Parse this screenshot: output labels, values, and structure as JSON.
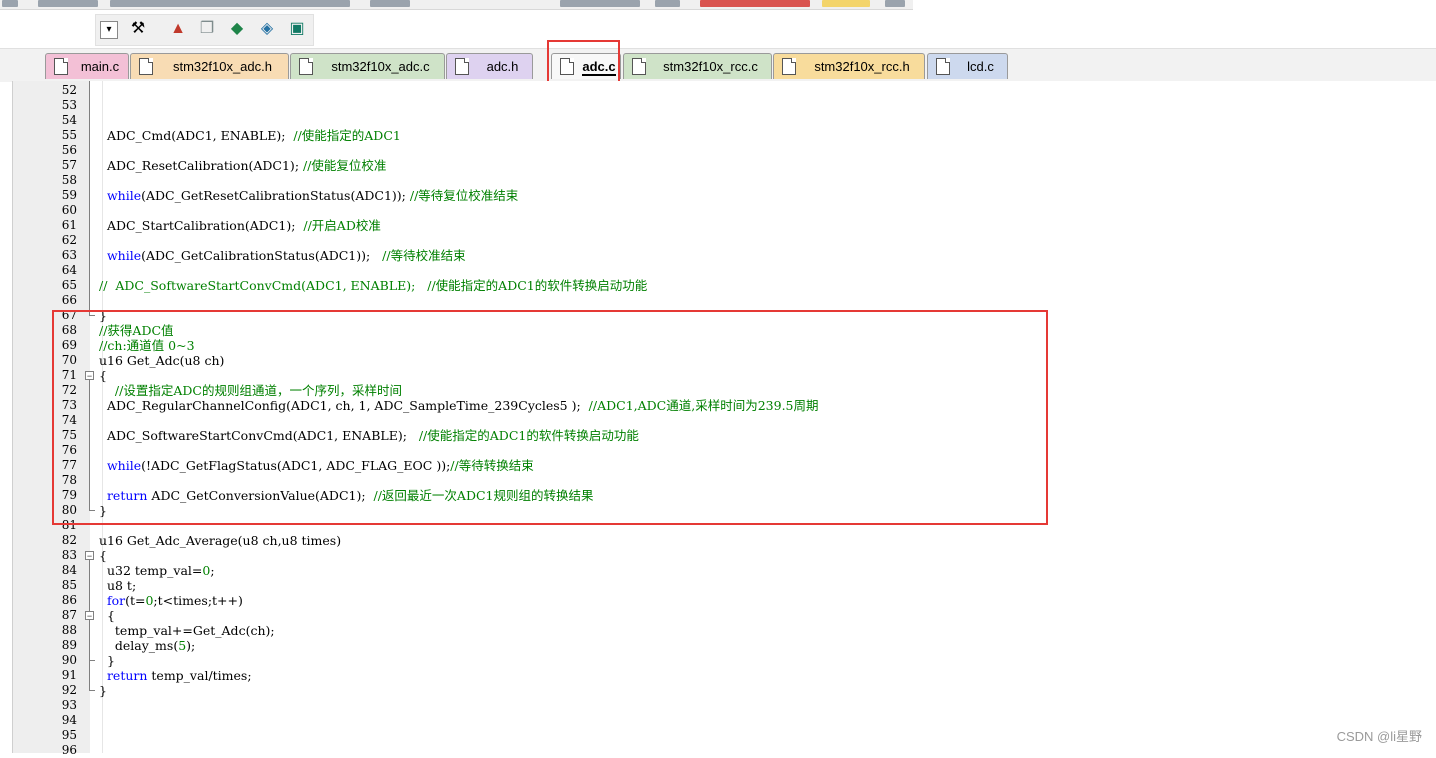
{
  "tabs": [
    {
      "label": "main.c",
      "color": "#f3c0d6"
    },
    {
      "label": "stm32f10x_adc.h",
      "color": "#f8dcb4"
    },
    {
      "label": "stm32f10x_adc.c",
      "color": "#cfe3c8"
    },
    {
      "label": "adc.h",
      "color": "#ded2f0"
    },
    {
      "label": "adc.c",
      "color": "#f8f8f8",
      "active": true
    },
    {
      "label": "stm32f10x_rcc.c",
      "color": "#cfe3c8"
    },
    {
      "label": "stm32f10x_rcc.h",
      "color": "#f8dc9c"
    },
    {
      "label": "lcd.c",
      "color": "#cdd9ee"
    }
  ],
  "editor": {
    "lines": [
      {
        "n": "52",
        "code": ""
      },
      {
        "n": "53",
        "code": ""
      },
      {
        "n": "54",
        "code": ""
      },
      {
        "n": "55",
        "code": "  ADC_Cmd(ADC1, ENABLE);  //使能指定的ADC1"
      },
      {
        "n": "56",
        "code": ""
      },
      {
        "n": "57",
        "code": "  ADC_ResetCalibration(ADC1); //使能复位校准"
      },
      {
        "n": "58",
        "code": ""
      },
      {
        "n": "59",
        "code": "  while(ADC_GetResetCalibrationStatus(ADC1)); //等待复位校准结束"
      },
      {
        "n": "60",
        "code": ""
      },
      {
        "n": "61",
        "code": "  ADC_StartCalibration(ADC1);  //开启AD校准"
      },
      {
        "n": "62",
        "code": ""
      },
      {
        "n": "63",
        "code": "  while(ADC_GetCalibrationStatus(ADC1));   //等待校准结束"
      },
      {
        "n": "64",
        "code": ""
      },
      {
        "n": "65",
        "code": "//  ADC_SoftwareStartConvCmd(ADC1, ENABLE);   //使能指定的ADC1的软件转换启动功能"
      },
      {
        "n": "66",
        "code": ""
      },
      {
        "n": "67",
        "code": "}"
      },
      {
        "n": "68",
        "code": "//获得ADC值"
      },
      {
        "n": "69",
        "code": "//ch:通道值 0~3"
      },
      {
        "n": "70",
        "code": "u16 Get_Adc(u8 ch)"
      },
      {
        "n": "71",
        "code": "{"
      },
      {
        "n": "72",
        "code": "    //设置指定ADC的规则组通道，一个序列，采样时间"
      },
      {
        "n": "73",
        "code": "  ADC_RegularChannelConfig(ADC1, ch, 1, ADC_SampleTime_239Cycles5 );  //ADC1,ADC通道,采样时间为239.5周期"
      },
      {
        "n": "74",
        "code": ""
      },
      {
        "n": "75",
        "code": "  ADC_SoftwareStartConvCmd(ADC1, ENABLE);   //使能指定的ADC1的软件转换启动功能"
      },
      {
        "n": "76",
        "code": ""
      },
      {
        "n": "77",
        "code": "  while(!ADC_GetFlagStatus(ADC1, ADC_FLAG_EOC ));//等待转换结束"
      },
      {
        "n": "78",
        "code": ""
      },
      {
        "n": "79",
        "code": "  return ADC_GetConversionValue(ADC1);  //返回最近一次ADC1规则组的转换结果"
      },
      {
        "n": "80",
        "code": "}"
      },
      {
        "n": "81",
        "code": ""
      },
      {
        "n": "82",
        "code": "u16 Get_Adc_Average(u8 ch,u8 times)"
      },
      {
        "n": "83",
        "code": "{"
      },
      {
        "n": "84",
        "code": "  u32 temp_val=0;"
      },
      {
        "n": "85",
        "code": "  u8 t;"
      },
      {
        "n": "86",
        "code": "  for(t=0;t<times;t++)"
      },
      {
        "n": "87",
        "code": "  {"
      },
      {
        "n": "88",
        "code": "    temp_val+=Get_Adc(ch);"
      },
      {
        "n": "89",
        "code": "    delay_ms(5);"
      },
      {
        "n": "90",
        "code": "  }"
      },
      {
        "n": "91",
        "code": "  return temp_val/times;"
      },
      {
        "n": "92",
        "code": "}"
      },
      {
        "n": "93",
        "code": ""
      },
      {
        "n": "94",
        "code": ""
      },
      {
        "n": "95",
        "code": ""
      },
      {
        "n": "96",
        "code": ""
      }
    ],
    "keyword_color": "#0000ff",
    "comment_color": "#008000"
  },
  "highlight_color": "#e53935",
  "watermark": "CSDN @li星野"
}
